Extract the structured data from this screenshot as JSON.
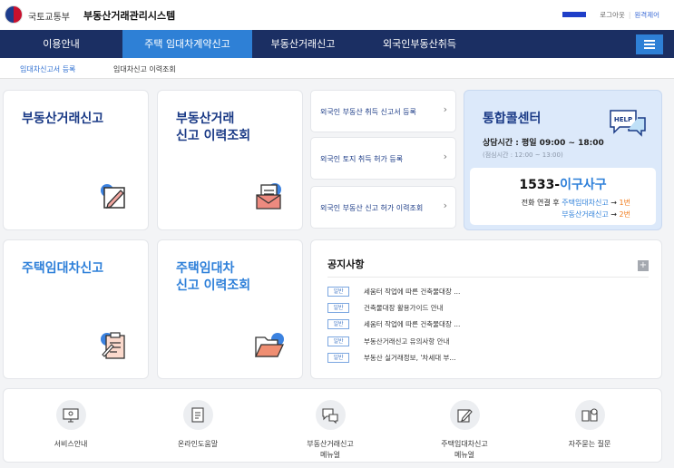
{
  "header": {
    "ministry": "국토교통부",
    "system_title": "부동산거래관리시스템",
    "logout": "로그아웃",
    "site_map": "원격제어"
  },
  "gnb": {
    "items": [
      "이용안내",
      "주택 임대차계약신고",
      "부동산거래신고",
      "외국인부동산취득"
    ],
    "active_index": 1
  },
  "subnav": [
    "임대차신고서 등록",
    "임대차신고 이력조회"
  ],
  "cards": {
    "real_estate_report": "부동산거래신고",
    "real_estate_history": "부동산거래\n신고 이력조회",
    "lease_report": "주택임대차신고",
    "lease_history": "주택임대차\n신고 이력조회"
  },
  "foreigner_links": [
    "외국인 부동산 취득 신고서 등록",
    "외국인 토지 취득 허가 등록",
    "외국인 부동산 신고 허가 이력조회"
  ],
  "call_center": {
    "title": "통합콜센터",
    "hours": "상담시간 : 평일 09:00 ~ 18:00",
    "lunch": "(점심시간 : 12:00 ~ 13:00)",
    "help_badge": "HELP",
    "number_prefix": "1533-",
    "number_suffix": "이구사구",
    "line1_prefix": "전화 연결 후 ",
    "line1_link": "주택임대차신고",
    "line1_arrow": " → ",
    "line1_num": "1번",
    "line2_link": "부동산거래신고",
    "line2_arrow": " → ",
    "line2_num": "2번"
  },
  "notice": {
    "title": "공지사항",
    "more": "+",
    "badge": "일반",
    "items": [
      "세움터 작업에 따른 건축물대장 ...",
      "건축물대장 활용가이드 안내",
      "세움터 작업에 따른 건축물대장 ...",
      "부동산거래신고 유의사항 안내",
      "부동산 실거래정보, '차세대 부..."
    ]
  },
  "quick_menu": [
    {
      "label": "서비스안내",
      "icon": "monitor-icon"
    },
    {
      "label": "온라인도움말",
      "icon": "document-icon"
    },
    {
      "label": "부동산거래신고\n메뉴얼",
      "icon": "chat-icon"
    },
    {
      "label": "주택임대차신고\n메뉴얼",
      "icon": "edit-icon"
    },
    {
      "label": "자주묻는 질문",
      "icon": "book-icon"
    }
  ],
  "colors": {
    "navy": "#1b2f63",
    "accent": "#2e80d6",
    "title_navy": "#1a3a86",
    "title_blue": "#2d7fd9",
    "orange": "#f07a1a"
  }
}
